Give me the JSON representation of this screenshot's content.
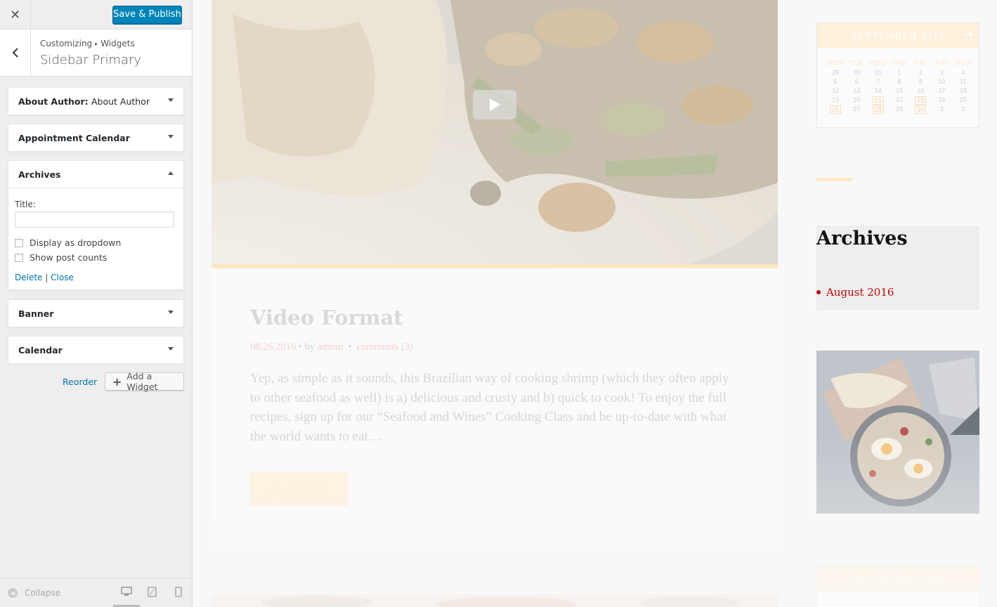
{
  "customizer": {
    "save_label": "Save & Publish",
    "breadcrumb_root": "Customizing",
    "breadcrumb_child": "Widgets",
    "section_title": "Sidebar Primary",
    "widgets": [
      {
        "title": "About Author:",
        "subtitle": "About Author",
        "expanded": false
      },
      {
        "title": "Appointment Calendar",
        "subtitle": "",
        "expanded": false
      },
      {
        "title": "Archives",
        "subtitle": "",
        "expanded": true
      },
      {
        "title": "Banner",
        "subtitle": "",
        "expanded": false
      },
      {
        "title": "Calendar",
        "subtitle": "",
        "expanded": false
      }
    ],
    "archives_form": {
      "title_label": "Title:",
      "title_value": "",
      "dropdown_label": "Display as dropdown",
      "dropdown_checked": false,
      "counts_label": "Show post counts",
      "counts_checked": false,
      "delete_label": "Delete",
      "separator": "|",
      "close_label": "Close"
    },
    "reorder_label": "Reorder",
    "add_widget_label": "Add a Widget",
    "collapse_label": "Collapse"
  },
  "preview": {
    "post": {
      "title": "Video Format",
      "date": "08.26.2016",
      "by": "• by",
      "author": "admin",
      "bullet": "•",
      "comments": "comments (3)",
      "excerpt": "Yep, as simple as it sounds, this Brazilian way of cooking shrimp (which they often apply to other seafood as well) is a) delicious and crusty and b) quick to cook! To enjoy the full recipes, sign up for our “Seafood and Wines” Cooking Class and be up-to-date with what the world wants to eat…",
      "read_more": "READ MORE"
    },
    "calendar": {
      "month": "SEPTEMBER 2016",
      "days": [
        "MON",
        "TUE",
        "WED",
        "THU",
        "FRI",
        "SAT",
        "SUN"
      ],
      "weeks": [
        [
          "29",
          "30",
          "31",
          "1",
          "2",
          "3",
          "4"
        ],
        [
          "5",
          "6",
          "7",
          "8",
          "9",
          "10",
          "11"
        ],
        [
          "12",
          "13",
          "14",
          "15",
          "16",
          "17",
          "18"
        ],
        [
          "19",
          "20",
          "21",
          "22",
          "23",
          "24",
          "25"
        ],
        [
          "26",
          "27",
          "28",
          "29",
          "30",
          "1",
          "2"
        ]
      ],
      "highlighted": [
        "21",
        "23",
        "26",
        "28",
        "30"
      ]
    },
    "archives": {
      "heading": "Archives",
      "items": [
        "August 2016"
      ]
    },
    "calendar2_month": "SEPTEMBER 2016"
  },
  "colors": {
    "primary_button": "#0085ba",
    "link": "#0073aa",
    "accent_peach": "#fde6c3",
    "archive_red": "#cc0000"
  },
  "icons": {
    "close": "close-icon",
    "back": "chevron-left-icon",
    "play": "play-icon",
    "add": "plus-icon",
    "collapse": "collapse-icon",
    "desktop": "desktop-icon",
    "tablet": "tablet-icon",
    "mobile": "mobile-icon",
    "calendar_next": "arrow-right-icon"
  }
}
